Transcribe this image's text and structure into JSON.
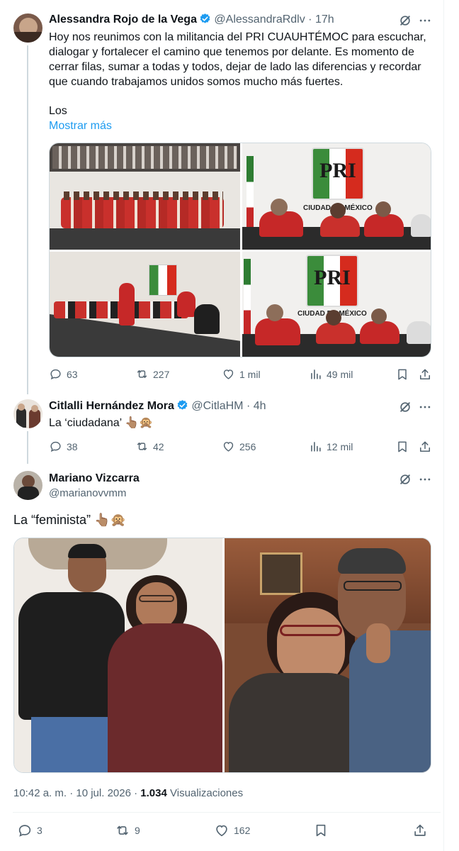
{
  "thread": [
    {
      "author": "Alessandra Rojo de la Vega",
      "handle": "@AlessandraRdlv",
      "time": "17h",
      "sep": "·",
      "text": "Hoy nos reunimos con la militancia del PRI CUAUHTÉMOC para escuchar, dialogar y fortalecer el camino que tenemos por delante. Es momento de cerrar filas, sumar a todas y todos, dejar de lado las diferencias y recordar que cuando trabajamos unidos somos mucho más fuertes.",
      "text2": "Los",
      "show_more": "Mostrar más",
      "photo_texts": {
        "logo": "PRI",
        "city": "CIUDAD DE MÉXICO"
      },
      "stats": {
        "replies": "63",
        "reposts": "227",
        "likes": "1 mil",
        "views": "49 mil"
      }
    },
    {
      "author": "Citlalli Hernández Mora",
      "handle": "@CitlaHM",
      "time": "4h",
      "sep": "·",
      "text": "La ‘ciudadana’ 👆🏽🙊",
      "stats": {
        "replies": "38",
        "reposts": "42",
        "likes": "256",
        "views": "12 mil"
      }
    }
  ],
  "main_tweet": {
    "author": "Mariano Vizcarra",
    "handle": "@marianovvmm",
    "text": "La “feminista” 👆🏽🙊",
    "timestamp": "10:42 a. m. · 10 jul. 2026 · ",
    "views_count": "1.034",
    "views_label": "Visualizaciones",
    "stats": {
      "replies": "3",
      "reposts": "9",
      "likes": "162"
    }
  },
  "icons": [
    "grok-icon",
    "more-icon",
    "reply-icon",
    "repost-icon",
    "like-icon",
    "views-icon",
    "bookmark-icon",
    "share-icon",
    "verified-badge-icon"
  ],
  "colors": {
    "accent": "#1d9bf0",
    "text": "#0f1419",
    "muted": "#536471",
    "line": "#cfd9de",
    "pri_red": "#d52b1e",
    "pri_green": "#3b8c3b"
  }
}
